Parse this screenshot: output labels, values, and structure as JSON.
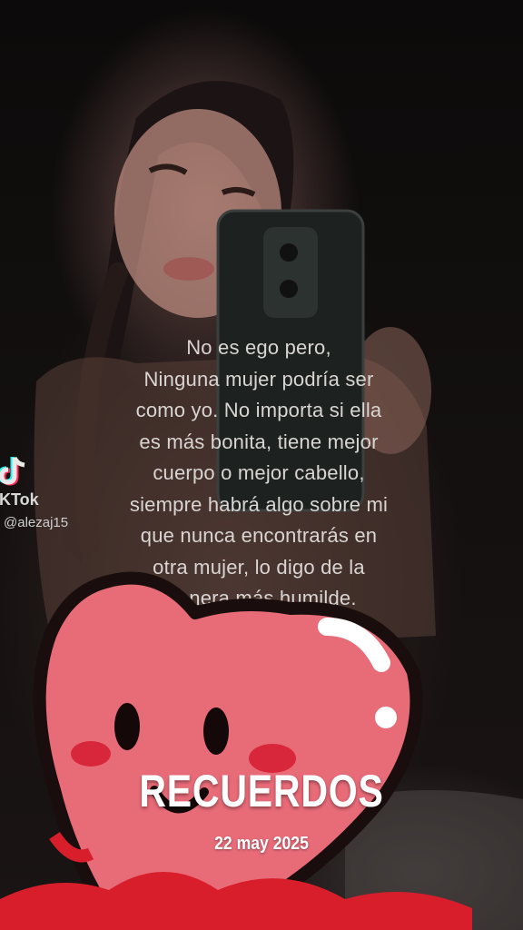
{
  "caption": {
    "lines": [
      "No es ego pero,",
      "Ninguna mujer podría ser",
      "como yo. No importa si ella",
      "es más bonita, tiene mejor",
      "cuerpo o mejor cabello,",
      "siempre habrá algo sobre mi",
      "que nunca encontrarás en",
      "otra mujer, lo digo de la",
      "manera más humilde."
    ]
  },
  "watermark": {
    "brand": "TikTok",
    "brand_visible": "iKTok",
    "username": "@alezaj15",
    "icon": "tiktok-logo-icon"
  },
  "memory": {
    "title": "RECUERDOS",
    "date": "22 may 2025"
  },
  "sticker": {
    "icon": "smiling-heart-sticker",
    "colors": {
      "heart": "#e86b78",
      "outline": "#1a0d0d",
      "cheeks": "#d8263a",
      "base": "#d81e2a"
    }
  }
}
